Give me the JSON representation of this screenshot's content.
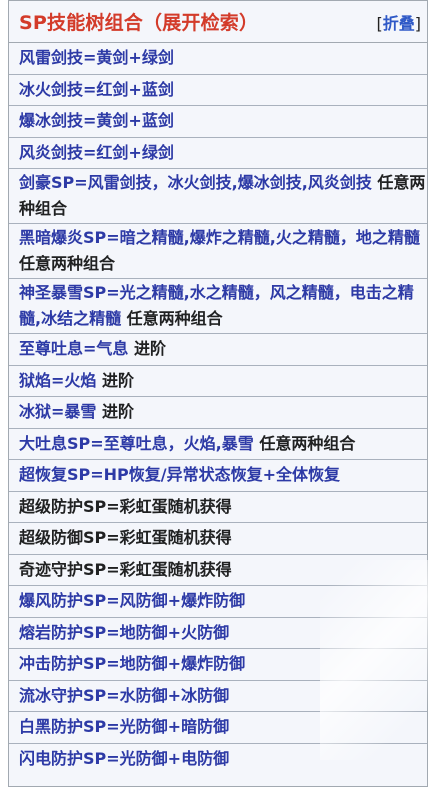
{
  "header": {
    "title": "SP技能树组合（展开检索）",
    "toggle_open": "[",
    "toggle_label": "折叠",
    "toggle_close": "]"
  },
  "rows": [
    {
      "kind": "link",
      "text": "风雷剑技=黄剑+绿剑"
    },
    {
      "kind": "link",
      "text": "冰火剑技=红剑+蓝剑"
    },
    {
      "kind": "link",
      "text": "爆冰剑技=黄剑+蓝剑"
    },
    {
      "kind": "link",
      "text": "风炎剑技=红剑+绿剑"
    },
    {
      "kind": "mixed",
      "link": "剑豪SP=风雷剑技，冰火剑技,爆冰剑技,风炎剑技",
      "plain": " 任意两种组合"
    },
    {
      "kind": "mixed",
      "link": "黑暗爆炎SP=暗之精髓,爆炸之精髓,火之精髓，地之精髓",
      "plain": " 任意两种组合"
    },
    {
      "kind": "mixed",
      "link": "神圣暴雪SP=光之精髓,水之精髓，风之精髓，电击之精髓,冰结之精髓",
      "plain": " 任意两种组合"
    },
    {
      "kind": "mixed",
      "link": "至尊吐息=气息",
      "plain": " 进阶"
    },
    {
      "kind": "mixed",
      "link": "狱焰=火焰",
      "plain": " 进阶"
    },
    {
      "kind": "mixed",
      "link": "冰狱=暴雪",
      "plain": " 进阶"
    },
    {
      "kind": "mixed",
      "link": "大吐息SP=至尊吐息，火焰,暴雪",
      "plain": " 任意两种组合"
    },
    {
      "kind": "link",
      "text": "超恢复SP=HP恢复/异常状态恢复+全体恢复"
    },
    {
      "kind": "plain",
      "text": "超级防护SP=彩虹蛋随机获得"
    },
    {
      "kind": "plain",
      "text": "超级防御SP=彩虹蛋随机获得"
    },
    {
      "kind": "plain",
      "text": "奇迹守护SP=彩虹蛋随机获得"
    },
    {
      "kind": "link",
      "text": "爆风防护SP=风防御+爆炸防御"
    },
    {
      "kind": "link",
      "text": "熔岩防护SP=地防御+火防御"
    },
    {
      "kind": "link",
      "text": "冲击防护SP=地防御+爆炸防御"
    },
    {
      "kind": "link",
      "text": "流冰守护SP=水防御+冰防御"
    },
    {
      "kind": "link",
      "text": "白黑防护SP=光防御+暗防御"
    },
    {
      "kind": "link",
      "text": "闪电防护SP=光防御+电防御"
    }
  ],
  "colors": {
    "title": "#d33b2a",
    "link": "#2d3aa6",
    "plain": "#202122",
    "background": "#f4f6fb",
    "border": "#a2a9b1"
  }
}
